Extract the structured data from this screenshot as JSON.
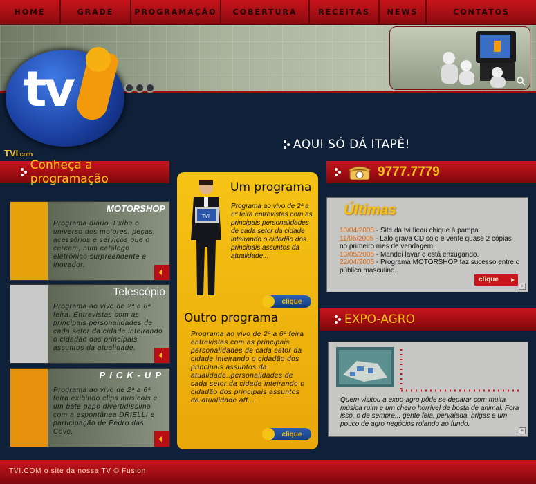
{
  "nav": [
    "HOME",
    "GRADE",
    "PROGRAMAÇÃO",
    "COBERTURA",
    "RECEITAS",
    "NEWS",
    "CONTATOS"
  ],
  "logo": {
    "text": "tv",
    "brand": "TVI",
    "brand_suffix": ".com"
  },
  "slogan": "AQUI SÓ DÁ ITAPÊ!",
  "left_header": "Conheça a programação",
  "cards": [
    {
      "name": "MOTORSHOP",
      "text": "Programa diário. Exibe o universo dos motores, peças, acessórios e serviços que o cercam, num catálogo eletrônico surpreendente e inovador.",
      "color": "#e7a20c"
    },
    {
      "name": "Telescópio",
      "text": "Programa ao vivo de 2ª a 6ª feira. Entrevistas com as principais personalidades de cada setor da cidade inteirando o cidadão dos principais assuntos da atualidade.",
      "color": "#c9c9c9"
    },
    {
      "name": "PICK-UP",
      "text": "Programa ao vivo de 2ª a 6ª feira exibindo clips musicais e um bate papo divertidíssimo com a espontânea DRIELLI e participação de Pedro das Cove.",
      "color": "#e7900b"
    }
  ],
  "center": {
    "program1_title": "Um programa",
    "program1_text": "Programa ao vivo de 2ª a 6ª feira entrevistas com as principais personalidades de cada setor da cidade inteirando o cidadão dos principais assuntos da atualidade...",
    "program2_title": "Outro programa",
    "program2_text": "Programa ao vivo de 2ª a 6ª feira entrevistas com as principais personalidades de cada setor da cidade inteirando o cidadão dos principais assuntos da atualidade..personalidades de cada setor da cidade inteirando o cidadão dos principais assuntos da atualidade aff....",
    "clique": "clique",
    "laptop_label": "TVI"
  },
  "phone": "9777.7779",
  "ultimas": {
    "title": "Últimas",
    "items": [
      {
        "date": "10/04/2005",
        "text": " - Site da tvi ficou chique à pampa."
      },
      {
        "date": "11/05/2005",
        "text": " - Lalo grava CD solo e venfe quase 2 cópias no primeiro mes de vendagem."
      },
      {
        "date": "13/05/2005",
        "text": " - Mandei lavar e está enxugando."
      },
      {
        "date": "22/04/2005",
        "text": " - Programa MOTORSHOP  faz sucesso entre o público masculino."
      }
    ],
    "clique": "clique"
  },
  "expo": {
    "title": "EXPO-AGRO",
    "text": "Quem visitou a expo-agro pôde se deparar com muita música ruim e um cheiro horrível de bosta de animal. Fora isso, o de sempre... gente feia, pervaiada, brigas e um pouco de agro negócios rolando ao fundo."
  },
  "footer": "TVI.COM o site da nossa TV © Fusion",
  "colors": {
    "red": "#c8141c",
    "yellow": "#f6c415",
    "navy": "#0f2039"
  }
}
